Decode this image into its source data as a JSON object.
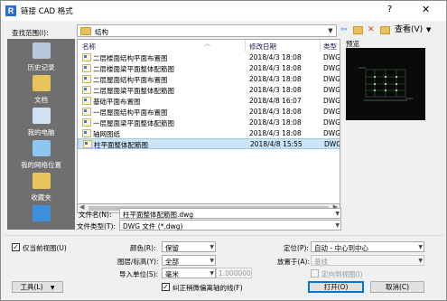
{
  "window": {
    "app_icon_letter": "R",
    "title": "链接 CAD 格式",
    "help": "?",
    "close": "✕"
  },
  "look_in": {
    "label": "查找范围(I):",
    "value": "结构"
  },
  "places": [
    {
      "label": "历史记录",
      "icon": "history-icon"
    },
    {
      "label": "文档",
      "icon": "documents-icon"
    },
    {
      "label": "我的电脑",
      "icon": "computer-icon"
    },
    {
      "label": "我的网络位置",
      "icon": "network-icon"
    },
    {
      "label": "收藏夹",
      "icon": "favorites-icon"
    },
    {
      "label": "",
      "icon": "desktop-icon"
    }
  ],
  "file_list": {
    "columns": [
      "名称",
      "修改日期",
      "类型"
    ],
    "rows": [
      {
        "name": "二层楼面结构平面布置图",
        "date": "2018/4/3 18:08",
        "type": "DWG"
      },
      {
        "name": "二层楼面梁平面整体配筋图",
        "date": "2018/4/3 18:08",
        "type": "DWG"
      },
      {
        "name": "二层屋面结构平面布置图",
        "date": "2018/4/3 18:08",
        "type": "DWG"
      },
      {
        "name": "二层屋面梁平面整体配筋图",
        "date": "2018/4/3 18:08",
        "type": "DWG"
      },
      {
        "name": "基础平面布置图",
        "date": "2018/4/8 16:07",
        "type": "DWG"
      },
      {
        "name": "一层屋面结构平面布置图",
        "date": "2018/4/3 18:08",
        "type": "DWG"
      },
      {
        "name": "一层屋面梁平面整体配筋图",
        "date": "2018/4/3 18:08",
        "type": "DWG"
      },
      {
        "name": "轴网图纸",
        "date": "2018/4/3 18:08",
        "type": "DWG"
      },
      {
        "name": "柱平面整体配筋图",
        "date": "2018/4/8 15:55",
        "type": "DWG",
        "selected": true
      }
    ]
  },
  "preview": {
    "label": "预览"
  },
  "file_name": {
    "label": "文件名(N):",
    "value": "柱平面整体配筋图.dwg"
  },
  "file_type": {
    "label": "文件类型(T):",
    "value": "DWG 文件 (*.dwg)"
  },
  "options": {
    "current_view_only": {
      "label": "仅当前视图(U)",
      "checked": true
    },
    "colors": {
      "label": "颜色(R):",
      "value": "保留"
    },
    "layers": {
      "label": "图层/标高(Y):",
      "value": "全部"
    },
    "import_units": {
      "label": "导入单位(S):",
      "value": "毫米",
      "factor": "1.000000"
    },
    "correct_lines": {
      "label": "纠正稍微偏离轴的线(F)",
      "checked": true
    },
    "positioning": {
      "label": "定位(P):",
      "value": "自动 - 中心到中心"
    },
    "place_at": {
      "label": "放置于(A):",
      "value": "基线"
    },
    "orient_to_view": {
      "label": "定向到视图(I)"
    }
  },
  "buttons": {
    "tools": "工具(L)",
    "open": "打开(O)",
    "cancel": "取消(C)"
  },
  "toolbar": {
    "views_label": "查看(V)"
  },
  "colors": {
    "places_bg": "#6f6f6f",
    "selection": "#cce4f7",
    "accent": "#0078d7"
  }
}
